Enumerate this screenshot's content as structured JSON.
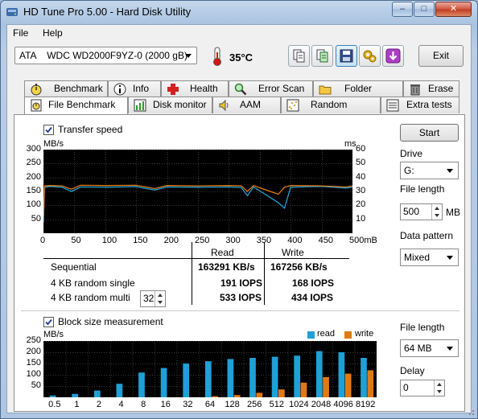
{
  "window": {
    "title": "HD Tune Pro 5.00 - Hard Disk Utility",
    "minimize": "–",
    "maximize": "□",
    "close": "✕"
  },
  "menu": {
    "file": "File",
    "help": "Help"
  },
  "toolbar": {
    "drive": "ATA    WDC WD2000F9YZ-0 (2000 gB)",
    "temperature": "35°C",
    "exit_label": "Exit",
    "icons": [
      "copy-icon",
      "copy-text-icon",
      "save-icon",
      "options-icon",
      "download-icon"
    ]
  },
  "tabs_top": [
    "Benchmark",
    "Info",
    "Health",
    "Error Scan",
    "Folder Usage",
    "Erase"
  ],
  "tabs_bottom": [
    "File Benchmark",
    "Disk monitor",
    "AAM",
    "Random Access",
    "Extra tests"
  ],
  "transfer": {
    "checkbox_label": "Transfer speed",
    "checked": true,
    "left_unit": "MB/s",
    "right_unit": "ms",
    "y_left_ticks": [
      "300",
      "250",
      "200",
      "150",
      "100",
      "50"
    ],
    "y_right_ticks": [
      "60",
      "50",
      "40",
      "30",
      "20",
      "10"
    ],
    "x_ticks": [
      "0",
      "50",
      "100",
      "150",
      "200",
      "250",
      "300",
      "350",
      "400",
      "450",
      "500mB"
    ]
  },
  "results": {
    "col_read": "Read",
    "col_write": "Write",
    "rows": [
      {
        "label": "Sequential",
        "read": "163291 KB/s",
        "write": "167256 KB/s"
      },
      {
        "label": "4 KB random single",
        "read": "191 IOPS",
        "write": "168 IOPS"
      },
      {
        "label": "4 KB random multi",
        "read": "533 IOPS",
        "write": "434 IOPS"
      }
    ],
    "queue_depth": "32"
  },
  "side_top": {
    "start_label": "Start",
    "drive_label": "Drive",
    "drive_value": "G:",
    "file_length_label": "File length",
    "file_length_value": "500",
    "file_length_unit": "MB",
    "data_pattern_label": "Data pattern",
    "data_pattern_value": "Mixed"
  },
  "block": {
    "checkbox_label": "Block size measurement",
    "checked": true,
    "unit": "MB/s",
    "legend_read": "read",
    "legend_write": "write",
    "y_ticks": [
      "250",
      "200",
      "150",
      "100",
      "50"
    ],
    "x_labels": [
      "0.5",
      "1",
      "2",
      "4",
      "8",
      "16",
      "32",
      "64",
      "128",
      "256",
      "512",
      "1024",
      "2048",
      "4096",
      "8192"
    ]
  },
  "side_bottom": {
    "file_length_label": "File length",
    "file_length_value": "64 MB",
    "delay_label": "Delay",
    "delay_value": "0"
  },
  "colors": {
    "read": "#1fa0d6",
    "write": "#e07a10",
    "chart_bg": "#000000",
    "grid": "#3a3a3a"
  },
  "chart_data": [
    {
      "type": "line",
      "title": "Transfer speed",
      "xlabel": "",
      "ylabel": "MB/s",
      "xlim": [
        0,
        500
      ],
      "ylim": [
        0,
        300
      ],
      "series": [
        {
          "name": "Read",
          "x": [
            0,
            2,
            10,
            30,
            45,
            60,
            100,
            150,
            180,
            200,
            250,
            300,
            320,
            330,
            340,
            380,
            390,
            400,
            450,
            490,
            500
          ],
          "values": [
            40,
            165,
            168,
            165,
            150,
            166,
            165,
            167,
            155,
            166,
            165,
            166,
            164,
            135,
            166,
            110,
            90,
            165,
            168,
            162,
            165
          ]
        },
        {
          "name": "Write",
          "x": [
            0,
            2,
            10,
            30,
            45,
            60,
            100,
            150,
            180,
            200,
            250,
            300,
            320,
            330,
            340,
            380,
            390,
            400,
            450,
            490,
            500
          ],
          "values": [
            60,
            170,
            171,
            170,
            158,
            172,
            171,
            172,
            160,
            171,
            170,
            171,
            170,
            150,
            171,
            140,
            165,
            171,
            170,
            166,
            170
          ]
        }
      ]
    },
    {
      "type": "bar",
      "title": "Block size measurement",
      "ylabel": "MB/s",
      "ylim": [
        0,
        250
      ],
      "categories": [
        "0.5",
        "1",
        "2",
        "4",
        "8",
        "16",
        "32",
        "64",
        "128",
        "256",
        "512",
        "1024",
        "2048",
        "4096",
        "8192"
      ],
      "series": [
        {
          "name": "read",
          "values": [
            8,
            15,
            30,
            60,
            110,
            130,
            150,
            160,
            170,
            175,
            180,
            185,
            205,
            200,
            175
          ]
        },
        {
          "name": "write",
          "values": [
            0,
            0,
            0,
            0,
            0,
            0,
            0,
            5,
            10,
            20,
            35,
            65,
            90,
            105,
            120
          ]
        }
      ]
    }
  ]
}
